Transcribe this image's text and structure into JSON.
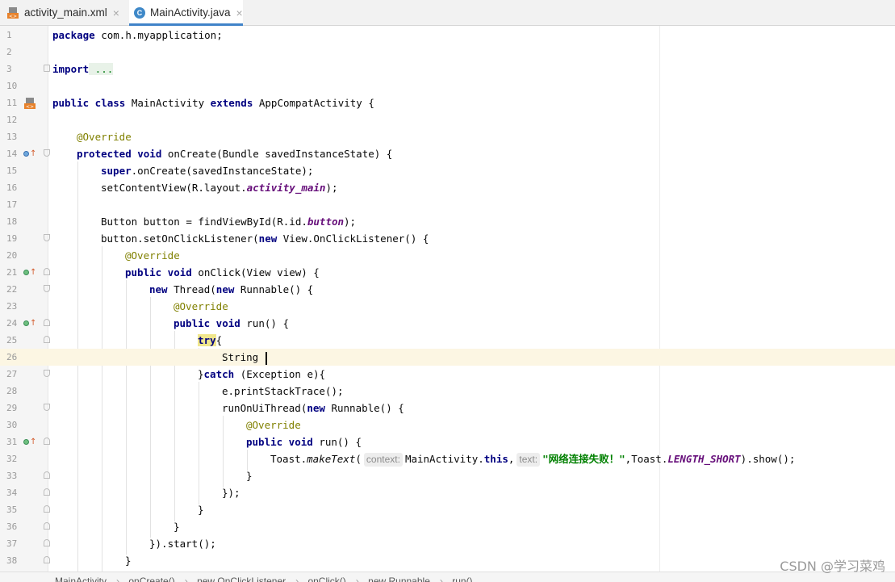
{
  "tabs": [
    {
      "label": "activity_main.xml",
      "icon": "xml-file-icon",
      "active": false
    },
    {
      "label": "MainActivity.java",
      "icon": "java-class-icon",
      "active": true
    }
  ],
  "editor": {
    "caret_line": "26",
    "lines": [
      {
        "num": "1"
      },
      {
        "num": "2"
      },
      {
        "num": "3"
      },
      {
        "num": "10"
      },
      {
        "num": "11"
      },
      {
        "num": "12"
      },
      {
        "num": "13"
      },
      {
        "num": "14"
      },
      {
        "num": "15"
      },
      {
        "num": "16"
      },
      {
        "num": "17"
      },
      {
        "num": "18"
      },
      {
        "num": "19"
      },
      {
        "num": "20"
      },
      {
        "num": "21"
      },
      {
        "num": "22"
      },
      {
        "num": "23"
      },
      {
        "num": "24"
      },
      {
        "num": "25"
      },
      {
        "num": "26"
      },
      {
        "num": "27"
      },
      {
        "num": "28"
      },
      {
        "num": "29"
      },
      {
        "num": "30"
      },
      {
        "num": "31"
      },
      {
        "num": "32"
      },
      {
        "num": "33"
      },
      {
        "num": "34"
      },
      {
        "num": "35"
      },
      {
        "num": "36"
      },
      {
        "num": "37"
      },
      {
        "num": "38"
      }
    ],
    "code": {
      "l1a": "package",
      "l1b": " com.h.myapplication;",
      "l3a": "import",
      "l3b": " ...",
      "l11a": "public class",
      "l11b": " MainActivity ",
      "l11c": "extends",
      "l11d": " AppCompatActivity {",
      "l13": "@Override",
      "l14a": "protected void",
      "l14b": " onCreate(Bundle savedInstanceState) {",
      "l15a": "super",
      "l15b": ".onCreate(savedInstanceState);",
      "l16a": "setContentView(R.layout.",
      "l16b": "activity_main",
      "l16c": ");",
      "l18a": "Button button = findViewById(R.id.",
      "l18b": "button",
      "l18c": ");",
      "l19a": "button.setOnClickListener(",
      "l19b": "new",
      "l19c": " View.OnClickListener() {",
      "l20": "@Override",
      "l21a": "public void",
      "l21b": " onClick(View view) {",
      "l22a": "new",
      "l22b": " Thread(",
      "l22c": "new",
      "l22d": " Runnable() {",
      "l23": "@Override",
      "l24a": "public void",
      "l24b": " run() {",
      "l25a": "try",
      "l25b": "{",
      "l26": "String ",
      "l27a": "}",
      "l27b": "catch",
      "l27c": " (Exception e){",
      "l28": "e.printStackTrace();",
      "l29a": "runOnUiThread(",
      "l29b": "new",
      "l29c": " Runnable() {",
      "l30": "@Override",
      "l31a": "public void",
      "l31b": " run() {",
      "l32a": "Toast.",
      "l32b": "makeText",
      "l32c": "(",
      "l32hint1": "context:",
      "l32d": "MainActivity.",
      "l32e": "this",
      "l32f": ",",
      "l32hint2": "text:",
      "l32g": "\"网络连接失败！\"",
      "l32h": ",Toast.",
      "l32i": "LENGTH_SHORT",
      "l32j": ").show();",
      "l33": "}",
      "l34": "});",
      "l35": "}",
      "l36": "}",
      "l37": "}).start();",
      "l38": "}"
    }
  },
  "breadcrumb": [
    "MainActivity",
    "onCreate()",
    "new OnClickListener",
    "onClick()",
    "new Runnable",
    "run()"
  ],
  "watermark": "CSDN @学习菜鸡"
}
